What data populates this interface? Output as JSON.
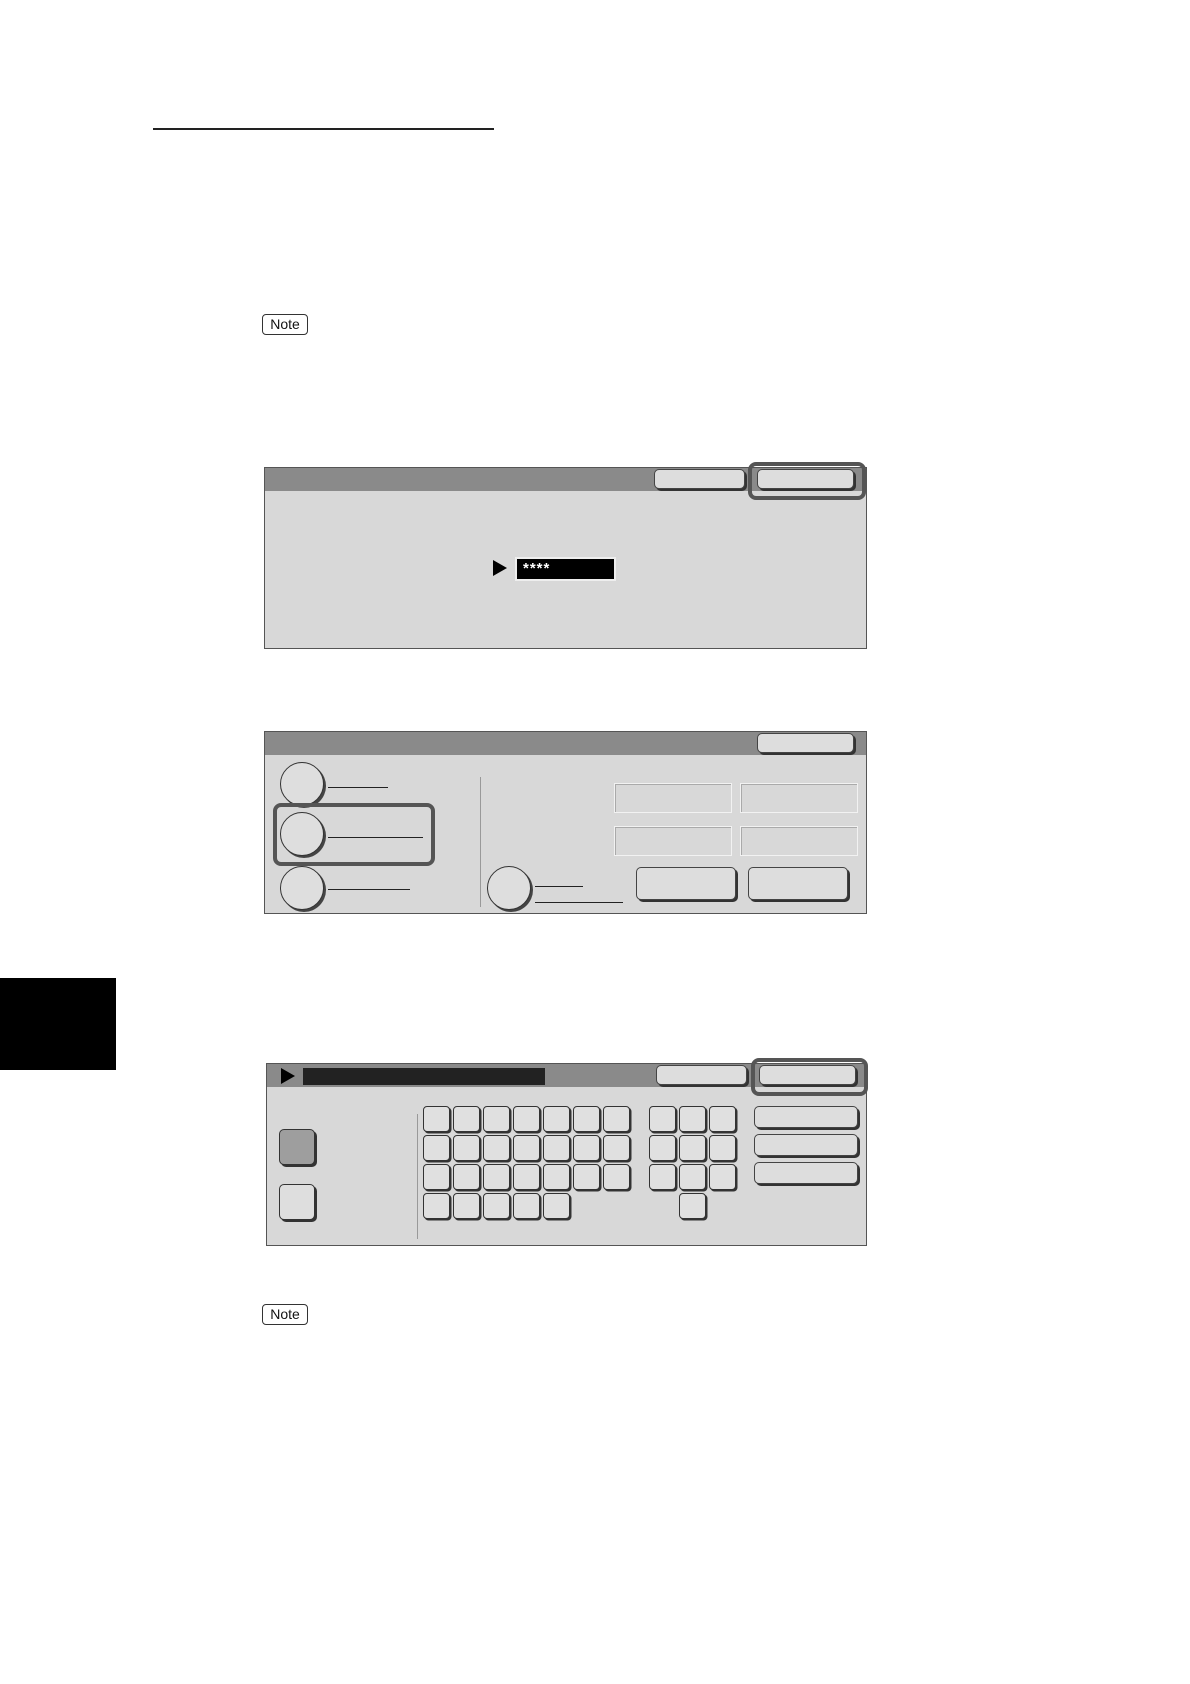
{
  "page": {
    "notes": [
      "Note",
      "Note"
    ]
  },
  "panel1": {
    "password_field": "****"
  },
  "panel3": {
    "keyboard_rows": [
      7,
      7,
      7,
      5
    ],
    "numpad_rows": [
      3,
      3,
      3,
      1
    ]
  }
}
